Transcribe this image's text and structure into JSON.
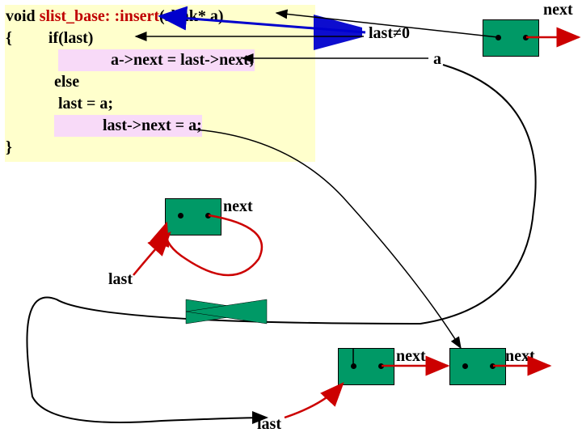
{
  "code": {
    "line1_prefix": "void ",
    "line1_class": "slist_base: :",
    "line1_method": "insert",
    "line1_suffix": "(slink* a)",
    "line2": "{         if(last)",
    "line3": "             a->next = last->next;",
    "line4": "            else",
    "line5": "             last = a;",
    "line6": "            last->next = a;",
    "line7": "}"
  },
  "labels": {
    "last_ne_0": "last≠0",
    "a": "a",
    "next_tr": "next",
    "next_mid": "next",
    "last_mid": "last",
    "next_b1": "next",
    "next_b2": "next",
    "last_bot": "last"
  },
  "colors": {
    "codebg": "#ffffcc",
    "pink": "#f8daf8",
    "node": "#009966",
    "red": "#cc0000",
    "blue": "#0000cc"
  }
}
